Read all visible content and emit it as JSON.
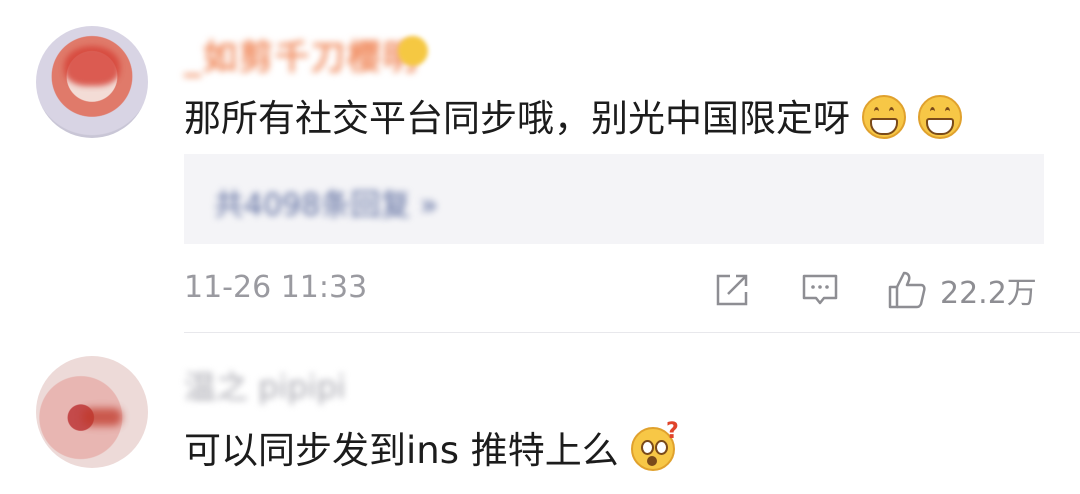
{
  "comments": [
    {
      "username": "_如剪千刀樱明",
      "text": "那所有社交平台同步哦，别光中国限定呀",
      "emojis": [
        "grin-emoji",
        "grin-emoji"
      ],
      "reply_link": "共4098条回复 »",
      "timestamp": "11-26 11:33",
      "likes": "22.2万"
    },
    {
      "username": "温之 pipipi",
      "text": "可以同步发到ins 推特上么",
      "emojis": [
        "wondering-emoji"
      ]
    }
  ],
  "icons": {
    "share": "share-icon",
    "comment": "comment-icon",
    "like": "thumbs-up-icon"
  },
  "colors": {
    "username": "#f08a5d",
    "reply_link": "#5b6b9e",
    "meta": "#9a9aa0",
    "reply_bg": "#f4f4f7"
  }
}
